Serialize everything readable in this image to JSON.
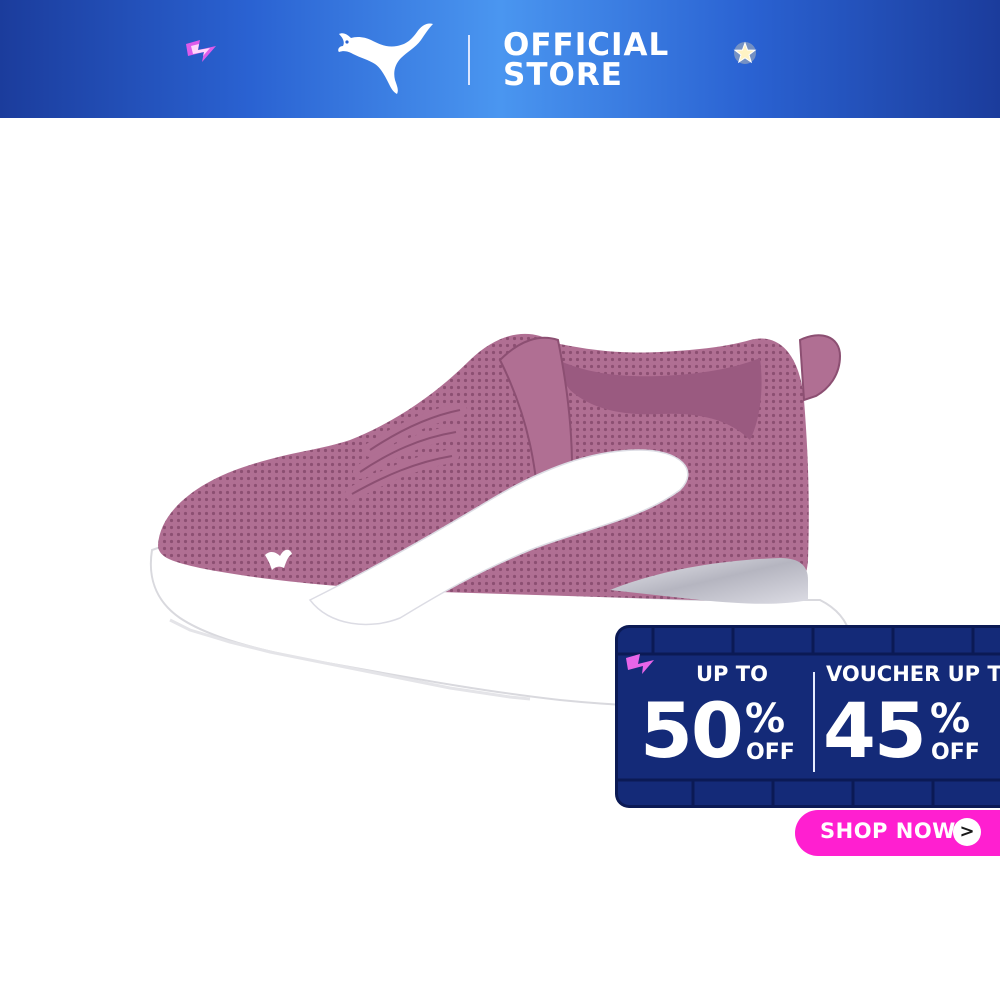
{
  "header": {
    "brand": "PUMA",
    "store_line1": "OFFICIAL",
    "store_line2": "STORE",
    "background_colors": [
      "#1b3c9c",
      "#4a96f0"
    ],
    "decor_icons": [
      "lightning-bolt-icon",
      "star-icon"
    ]
  },
  "product": {
    "image": "sneaker-image",
    "colors": {
      "upper": "#b06f93",
      "stripe": "#ffffff",
      "sole": "#ffffff",
      "heel_counter": "#b9b9c4"
    }
  },
  "promo": {
    "left_label": "UP TO",
    "left_value": "50",
    "left_pct": "%",
    "left_off": "OFF",
    "right_label": "VOUCHER UP TO",
    "right_value": "45",
    "right_pct": "%",
    "right_off": "OFF",
    "colors": {
      "panel": "#142a78",
      "brick_border": "#0b1a55",
      "accent": "#ff1fd0"
    }
  },
  "cta": {
    "label": "SHOP NOW",
    "arrow": ">",
    "color": "#ff1fd0"
  }
}
